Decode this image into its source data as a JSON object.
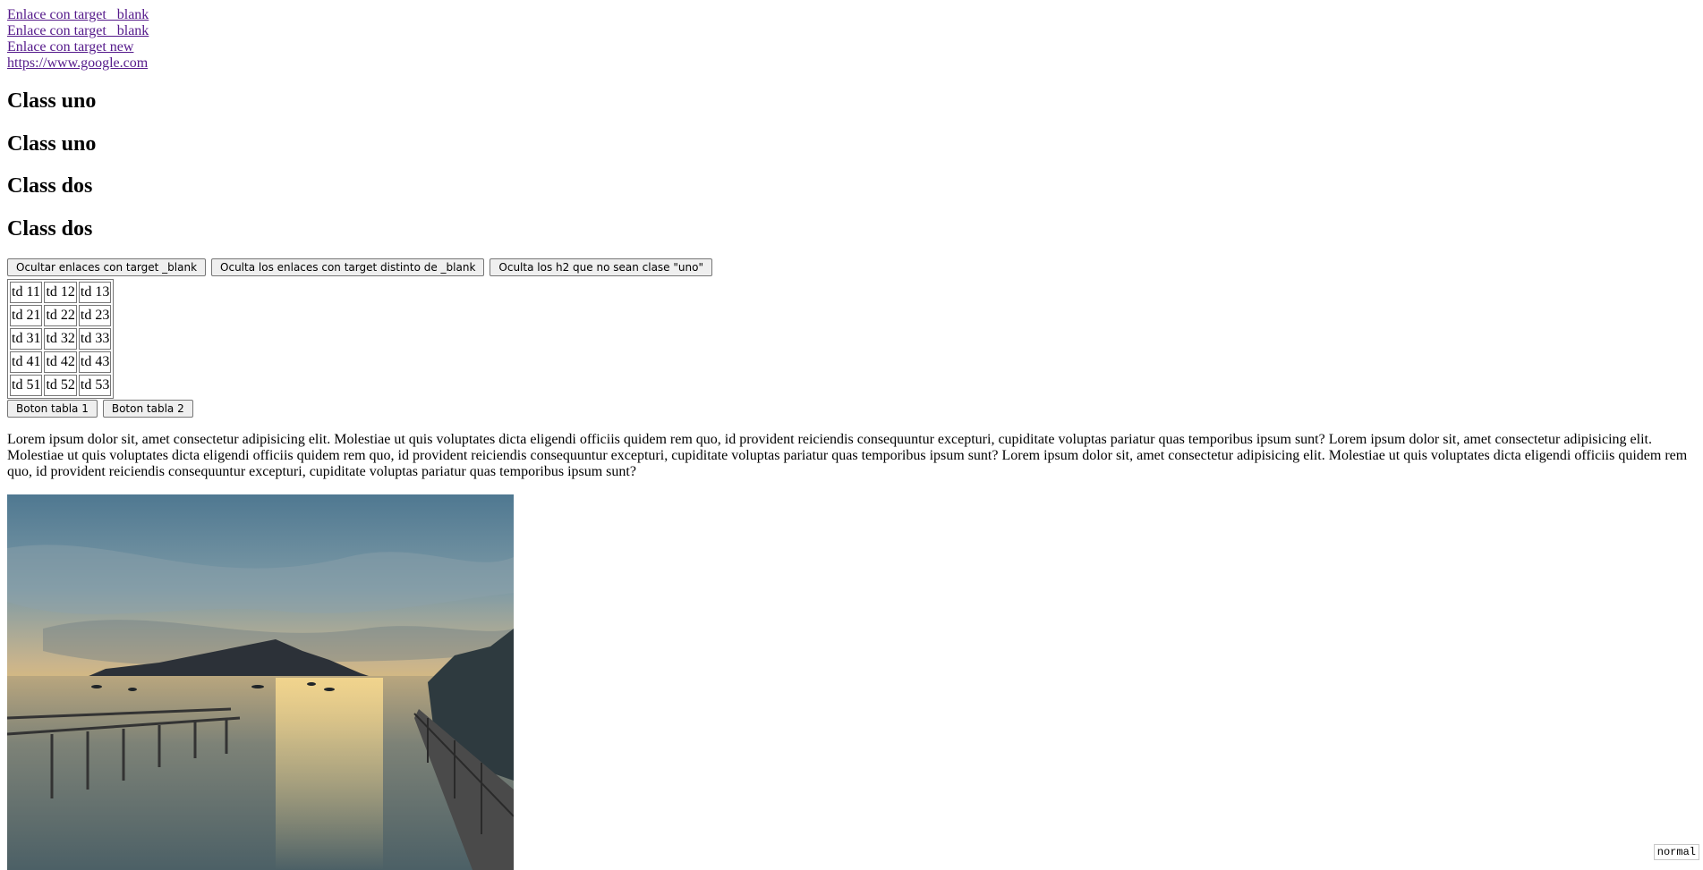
{
  "links": [
    {
      "label": "Enlace con target _blank"
    },
    {
      "label": "Enlace con target _blank"
    },
    {
      "label": "Enlace con target new"
    },
    {
      "label": "https://www.google.com"
    }
  ],
  "headings": [
    {
      "label": "Class uno"
    },
    {
      "label": "Class uno"
    },
    {
      "label": "Class dos"
    },
    {
      "label": "Class dos"
    }
  ],
  "buttons": {
    "hide_blank": "Ocultar enlaces con target _blank",
    "hide_not_blank": "Oculta los enlaces con target distinto de _blank",
    "hide_h2": "Oculta los h2 que no sean clase \"uno\""
  },
  "table": {
    "rows": [
      [
        "td 11",
        "td 12",
        "td 13"
      ],
      [
        "td 21",
        "td 22",
        "td 23"
      ],
      [
        "td 31",
        "td 32",
        "td 33"
      ],
      [
        "td 41",
        "td 42",
        "td 43"
      ],
      [
        "td 51",
        "td 52",
        "td 53"
      ]
    ]
  },
  "table_buttons": {
    "tabla1": "Boton tabla 1",
    "tabla2": "Boton tabla 2"
  },
  "paragraph": "Lorem ipsum dolor sit, amet consectetur adipisicing elit. Molestiae ut quis voluptates dicta eligendi officiis quidem rem quo, id provident reiciendis consequuntur excepturi, cupiditate voluptas pariatur quas temporibus ipsum sunt? Lorem ipsum dolor sit, amet consectetur adipisicing elit. Molestiae ut quis voluptates dicta eligendi officiis quidem rem quo, id provident reiciendis consequuntur excepturi, cupiditate voluptas pariatur quas temporibus ipsum sunt? Lorem ipsum dolor sit, amet consectetur adipisicing elit. Molestiae ut quis voluptates dicta eligendi officiis quidem rem quo, id provident reiciendis consequuntur excepturi, cupiditate voluptas pariatur quas temporibus ipsum sunt?",
  "status_text": "normal",
  "colors": {
    "link_visited": "#551a8b",
    "button_bg": "#efefef",
    "button_border": "#767676"
  }
}
